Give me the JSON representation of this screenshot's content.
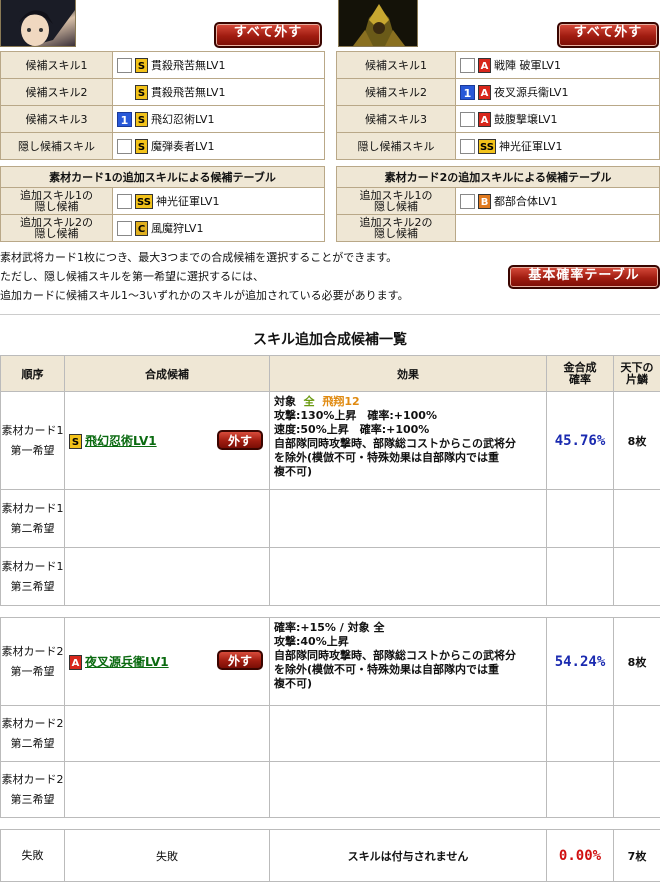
{
  "left_panel": {
    "remove_all": "すべて外す",
    "rows": [
      {
        "label": "候補スキル1",
        "checkbox": true,
        "rank": "S",
        "skill": "貫殺飛苦無LV1"
      },
      {
        "label": "候補スキル2",
        "checkbox": false,
        "rank": "S",
        "skill": "貫殺飛苦無LV1"
      },
      {
        "label": "候補スキル3",
        "selected_num": "1",
        "rank": "S",
        "skill": "飛幻忍術LV1"
      },
      {
        "label": "隠し候補スキル",
        "checkbox": true,
        "rank": "S",
        "skill": "魔弾奏者LV1"
      }
    ],
    "extra_title": "素材カード1の追加スキルによる候補テーブル",
    "extra_rows": [
      {
        "label": "追加スキル1の\n隠し候補",
        "rank": "SS",
        "skill": "神光征軍LV1"
      },
      {
        "label": "追加スキル2の\n隠し候補",
        "rank": "C",
        "skill": "風魔狩LV1"
      }
    ]
  },
  "right_panel": {
    "remove_all": "すべて外す",
    "rows": [
      {
        "label": "候補スキル1",
        "rank": "A",
        "skill": "戦陣 破軍LV1"
      },
      {
        "label": "候補スキル2",
        "selected_num": "1",
        "rank": "A",
        "skill": "夜叉源兵衞LV1"
      },
      {
        "label": "候補スキル3",
        "rank": "A",
        "skill": "鼓腹撃壌LV1"
      },
      {
        "label": "隠し候補スキル",
        "rank": "SS",
        "skill": "神光征軍LV1"
      }
    ],
    "extra_title": "素材カード2の追加スキルによる候補テーブル",
    "extra_rows": [
      {
        "label": "追加スキル1の\n隠し候補",
        "rank": "B",
        "skill": "都部合体LV1"
      },
      {
        "label": "追加スキル2の\n隠し候補",
        "rank": "",
        "skill": ""
      }
    ]
  },
  "notes": [
    "素材武将カード1枚につき、最大3つまでの合成候補を選択することができます。",
    "ただし、隠し候補スキルを第一希望に選択するには、",
    "追加カードに候補スキル1～3いずれかのスキルが追加されている必要があります。"
  ],
  "basic_rate_button": "基本確率テーブル",
  "list_title": "スキル追加合成候補一覧",
  "headers": {
    "order": "順序",
    "candidate": "合成候補",
    "effect": "効果",
    "rate": "金合成\n確率",
    "tenka": "天下の\n片鱗"
  },
  "rows": [
    {
      "order": "素材カード1\n第一希望",
      "rank": "S",
      "skill": "飛幻忍術LV1",
      "remove": "外す",
      "effect_lines": [
        "対象 全 飛翔12",
        "攻撃:130%上昇　確率:+100%",
        "速度:50%上昇　確率:+100%",
        "自部隊同時攻撃時、部隊総コストからこの武将分",
        "を除外(模倣不可・特殊効果は自部隊内では重",
        "複不可)"
      ],
      "target_label": "対象",
      "target_all": "全",
      "target_unit": "飛翔12",
      "rate": "45.76%",
      "count": "8枚"
    },
    {
      "order": "素材カード1\n第二希望"
    },
    {
      "order": "素材カード1\n第三希望"
    },
    {
      "order": "素材カード2\n第一希望",
      "rank": "A",
      "skill": "夜叉源兵衞LV1",
      "remove": "外す",
      "effect_lines": [
        "確率:+15% / 対象 全",
        "攻撃:40%上昇",
        "自部隊同時攻撃時、部隊総コストからこの武将分",
        "を除外(模倣不可・特殊効果は自部隊内では重",
        "複不可)"
      ],
      "rate": "54.24%",
      "count": "8枚"
    },
    {
      "order": "素材カード2\n第二希望"
    },
    {
      "order": "素材カード2\n第三希望"
    }
  ],
  "fail_row": {
    "order": "失敗",
    "candidate": "失敗",
    "effect": "スキルは付与されません",
    "rate": "0.00%",
    "count": "7枚"
  },
  "colors": {
    "rate_blue": "#1a2ab0",
    "rate_red": "#d01010",
    "link_green": "#0a6a10",
    "accent_red": "#a01c10"
  }
}
